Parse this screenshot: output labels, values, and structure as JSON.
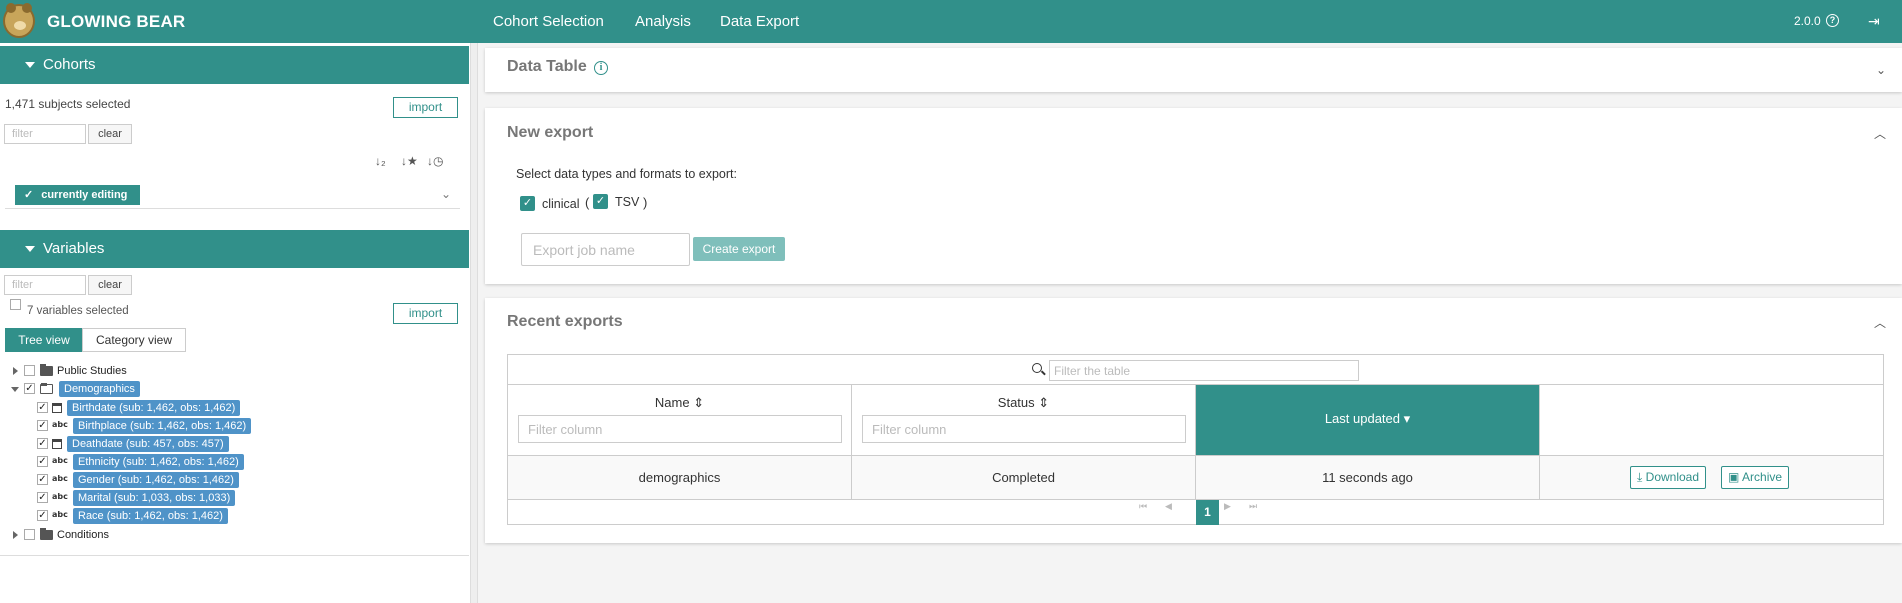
{
  "topbar": {
    "brand": "GLOWING BEAR",
    "nav": [
      "Cohort Selection",
      "Analysis",
      "Data Export"
    ],
    "version": "2.0.0"
  },
  "cohorts": {
    "title": "Cohorts",
    "selected_text": "1,471 subjects selected",
    "import_label": "import",
    "filter_placeholder": "filter",
    "clear_label": "clear",
    "editing_label": "currently editing"
  },
  "variables": {
    "title": "Variables",
    "filter_placeholder": "filter",
    "clear_label": "clear",
    "selected_text": "7 variables selected",
    "import_label": "import",
    "tree_view_label": "Tree view",
    "category_view_label": "Category view",
    "tree": {
      "public_studies": "Public Studies",
      "demographics": "Demographics",
      "items": [
        {
          "label": "Birthdate (sub: 1,462, obs: 1,462)",
          "type": "date"
        },
        {
          "label": "Birthplace (sub: 1,462, obs: 1,462)",
          "type": "text"
        },
        {
          "label": "Deathdate (sub: 457, obs: 457)",
          "type": "date"
        },
        {
          "label": "Ethnicity (sub: 1,462, obs: 1,462)",
          "type": "text"
        },
        {
          "label": "Gender (sub: 1,462, obs: 1,462)",
          "type": "text"
        },
        {
          "label": "Marital (sub: 1,033, obs: 1,033)",
          "type": "text"
        },
        {
          "label": "Race (sub: 1,462, obs: 1,462)",
          "type": "text"
        }
      ],
      "abc": "abc",
      "conditions": "Conditions"
    }
  },
  "data_table": {
    "title": "Data Table",
    "info": "i"
  },
  "new_export": {
    "title": "New export",
    "instructions": "Select data types and formats to export:",
    "type_label": "clinical",
    "paren_open": "(",
    "format_label": "TSV",
    "paren_close": ")",
    "job_placeholder": "Export job name",
    "create_label": "Create export"
  },
  "recent_exports": {
    "title": "Recent exports",
    "filter_placeholder": "Filter the table",
    "columns": [
      "Name",
      "Status",
      "Last updated"
    ],
    "column_filter_placeholder": "Filter column",
    "rows": [
      {
        "name": "demographics",
        "status": "Completed",
        "updated": "11 seconds ago"
      }
    ],
    "download_label": "Download",
    "archive_label": "Archive",
    "page": "1"
  },
  "colors": {
    "accent": "#31908a",
    "tag_blue": "#4f93c8"
  }
}
